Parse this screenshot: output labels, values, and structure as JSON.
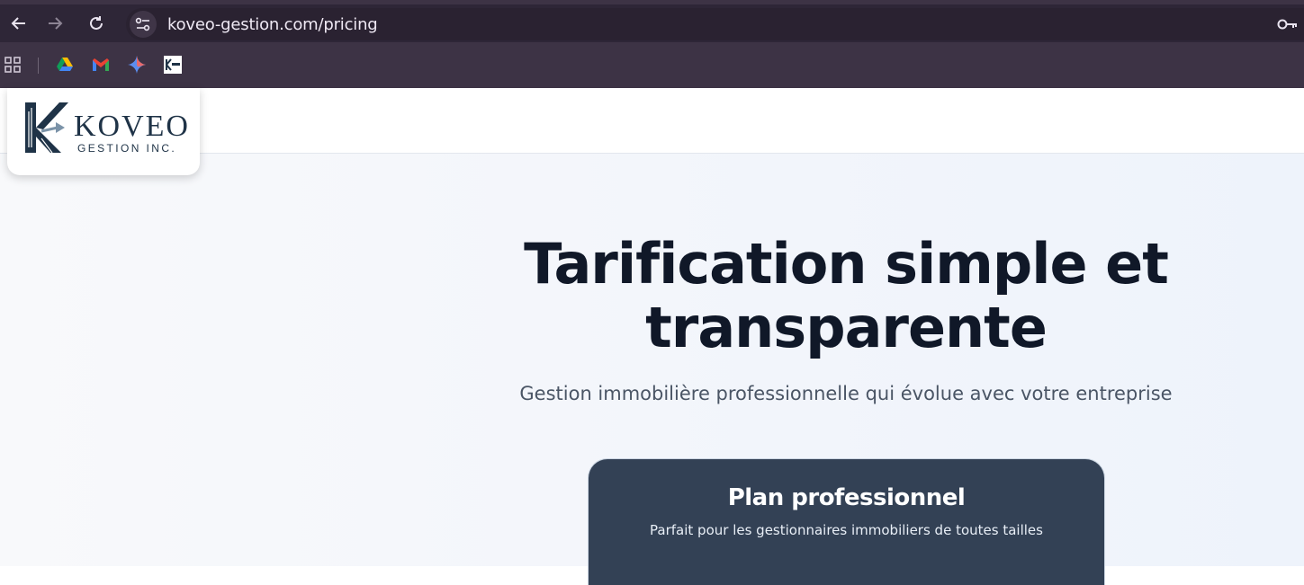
{
  "browser": {
    "url": "koveo-gestion.com/pricing",
    "nav": {
      "back_icon": "arrow-left-icon",
      "forward_icon": "arrow-right-icon",
      "reload_icon": "reload-icon"
    },
    "bookmarks": [
      {
        "name": "apps-grid-icon"
      },
      {
        "name": "google-drive-icon"
      },
      {
        "name": "gmail-icon"
      },
      {
        "name": "gemini-icon"
      },
      {
        "name": "koveo-bookmark-icon"
      }
    ]
  },
  "site": {
    "logo": {
      "word": "KOVEO",
      "sub": "GESTION INC."
    }
  },
  "hero": {
    "title": "Tarification simple et transparente",
    "subtitle": "Gestion immobilière professionnelle qui évolue avec votre entreprise"
  },
  "plan": {
    "title": "Plan professionnel",
    "description": "Parfait pour les gestionnaires immobiliers de toutes tailles"
  },
  "colors": {
    "browser_frame": "#3d3345",
    "toolbar": "#2e2637",
    "heading": "#101828",
    "plan_card": "#334155",
    "logo_navy": "#1f3347"
  }
}
